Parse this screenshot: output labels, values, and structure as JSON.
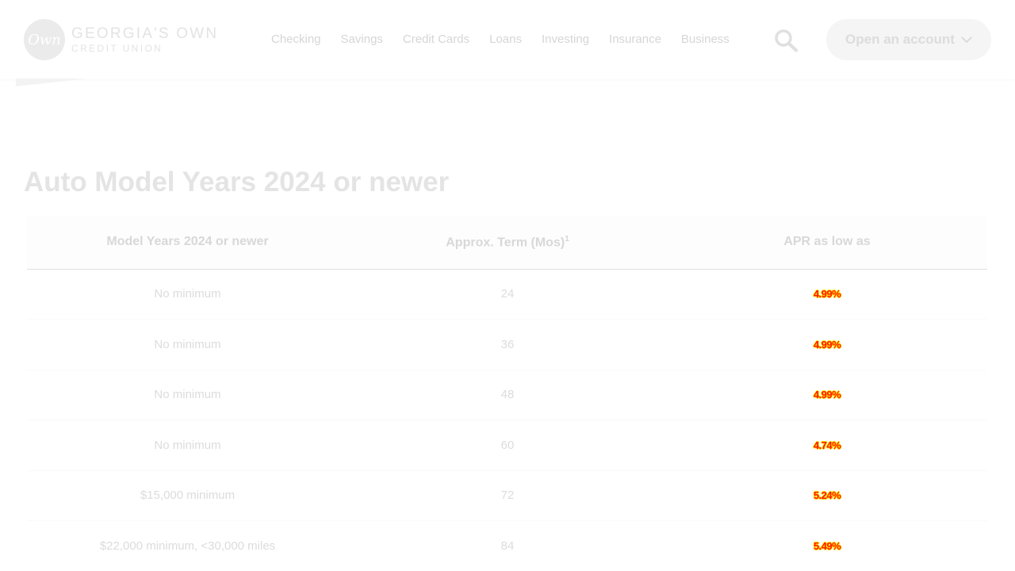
{
  "header": {
    "logo": {
      "mark_text": "Own",
      "line1": "GEORGIA'S OWN",
      "line2": "CREDIT UNION"
    },
    "nav": [
      "Checking",
      "Savings",
      "Credit Cards",
      "Loans",
      "Investing",
      "Insurance",
      "Business"
    ],
    "search_icon": "search-icon",
    "cta_label": "Open an account",
    "cta_icon": "chevron-down-icon"
  },
  "main": {
    "title": "Auto Model Years 2024 or newer",
    "table": {
      "headers": {
        "col1": "Model Years 2024 or newer",
        "col2": "Approx. Term (Mos)",
        "col2_sup": "1",
        "col3": "APR as low as"
      },
      "rows": [
        {
          "requirement": "No minimum",
          "term": "24",
          "apr": "4.99%"
        },
        {
          "requirement": "No minimum",
          "term": "36",
          "apr": "4.99%"
        },
        {
          "requirement": "No minimum",
          "term": "48",
          "apr": "4.99%"
        },
        {
          "requirement": "No minimum",
          "term": "60",
          "apr": "4.74%"
        },
        {
          "requirement": "$15,000 minimum",
          "term": "72",
          "apr": "5.24%"
        },
        {
          "requirement": "$22,000 minimum, <30,000 miles",
          "term": "84",
          "apr": "5.49%"
        }
      ]
    }
  },
  "colors": {
    "background": "#ffffff",
    "text_faded": "#d9d9d9",
    "apr_glitch_red": "#ff1a00",
    "apr_glitch_yellow": "#ffd000"
  }
}
